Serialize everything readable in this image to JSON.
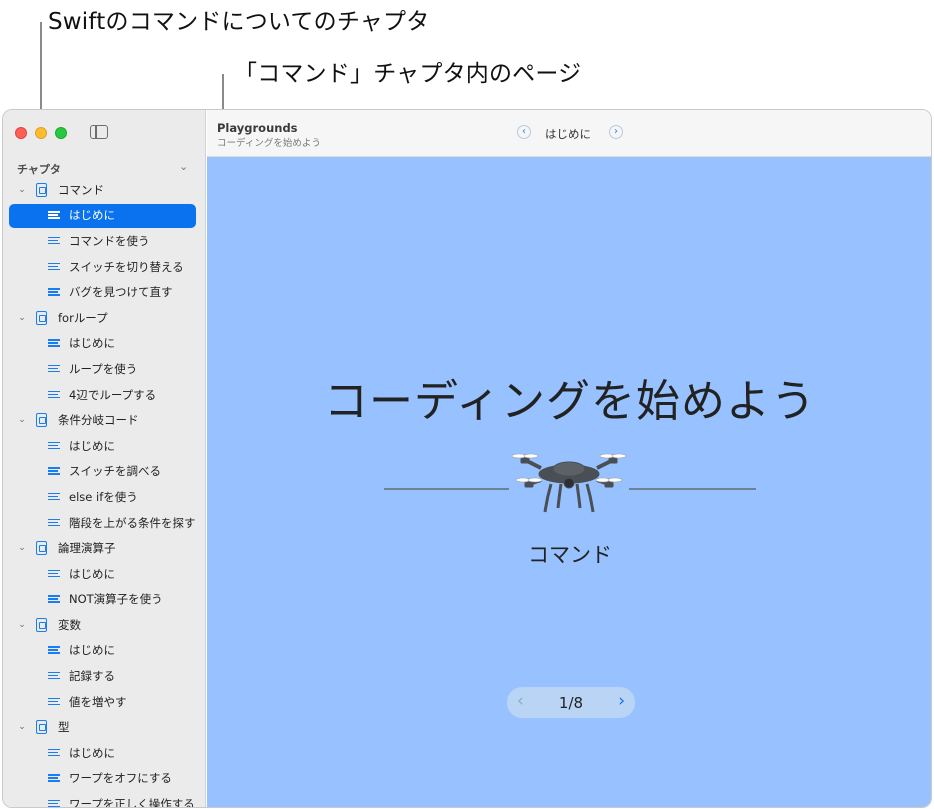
{
  "callouts": {
    "swift_commands_chapter": "Swiftのコマンドについてのチャプタ",
    "command_chapter_pages": "「コマンド」チャプタ内のページ"
  },
  "sidebar": {
    "section_label": "チャプタ",
    "chapters": [
      {
        "label": "コマンド",
        "expanded": true,
        "pages": [
          "はじめに",
          "コマンドを使う",
          "スイッチを切り替える",
          "バグを見つけて直す"
        ]
      },
      {
        "label": "forループ",
        "expanded": true,
        "pages": [
          "はじめに",
          "ループを使う",
          "4辺でループする"
        ]
      },
      {
        "label": "条件分岐コード",
        "expanded": true,
        "pages": [
          "はじめに",
          "スイッチを調べる",
          "else ifを使う",
          "階段を上がる条件を探す"
        ]
      },
      {
        "label": "論理演算子",
        "expanded": true,
        "pages": [
          "はじめに",
          "NOT演算子を使う"
        ]
      },
      {
        "label": "変数",
        "expanded": true,
        "pages": [
          "はじめに",
          "記録する",
          "値を増やす"
        ]
      },
      {
        "label": "型",
        "expanded": true,
        "pages": [
          "はじめに",
          "ワープをオフにする",
          "ワープを正しく操作する"
        ]
      }
    ],
    "selected": "コマンド / はじめに"
  },
  "titlebar": {
    "app_title": "Playgrounds",
    "app_subtitle": "コーディングを始めよう",
    "page_title": "はじめに"
  },
  "content": {
    "main_title": "コーディングを始めよう",
    "chapter_name": "コマンド",
    "pager": "1/8",
    "background_color": "#97c1ff"
  },
  "colors": {
    "accent": "#0a72ef",
    "close": "#fe5f57",
    "minimize": "#febc2e",
    "maximize": "#28c840"
  }
}
